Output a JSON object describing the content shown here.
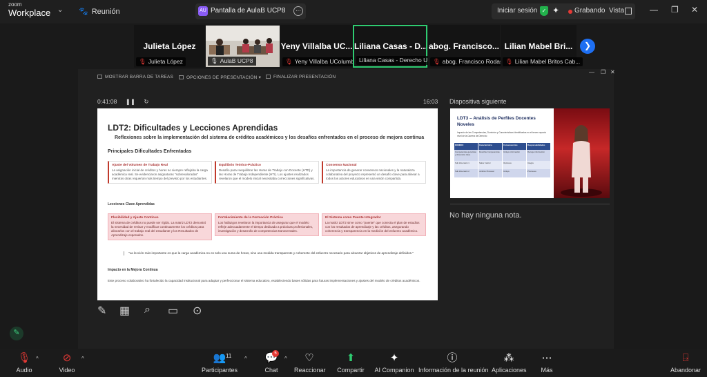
{
  "app": {
    "brand_small": "zoom",
    "brand_big": "Workplace",
    "meeting_label": "Reunión"
  },
  "share": {
    "badge": "AU",
    "title": "Pantalla de AulaB UCP8"
  },
  "topright": {
    "login": "Iniciar sesión",
    "recording": "Grabando",
    "view": "Vista"
  },
  "participants": [
    {
      "name": "Julieta López",
      "label": "Julieta López"
    },
    {
      "name": "",
      "label": "AulaB UCP8"
    },
    {
      "name": "Yeny Villalba UC...",
      "label": "Yeny Villalba UColumb..."
    },
    {
      "name": "Liliana Casas - D...",
      "label": "Liliana Casas - Derecho U..."
    },
    {
      "name": "abog. Francisco...",
      "label": "abog. Francisco Rodas"
    },
    {
      "name": "Lilian Mabel Bri...",
      "label": "Lilian Mabel Britos Cab..."
    }
  ],
  "presenter": {
    "show_taskbar": "MOSTRAR BARRA DE TAREAS",
    "options": "OPCIONES DE PRESENTACIÓN ▾",
    "end": "FINALIZAR PRESENTACIÓN",
    "elapsed": "0:41:08",
    "clock": "16:03",
    "next_slide": "Diapositiva siguiente",
    "notes": "No hay ninguna nota."
  },
  "slide": {
    "title": "LDT2: Dificultades y Lecciones Aprendidas",
    "subtitle": "Reflexiones sobre la implementación del sistema de créditos académicos y los desafíos enfrentados en el proceso de mejora continua",
    "h_difficulties": "Principales Dificultades Enfrentadas",
    "cards": [
      {
        "title": "Ajuste del Volumen de Trabajo Real",
        "body": "La asignación inicial de créditos y horas no siempre reflejaba la carga académica real. Se evidenciaron asignaturas \"sobrevaloradas\" mientras otras requerían más tiempo del previsto por los estudiantes."
      },
      {
        "title": "Equilibrio Teórico-Práctico",
        "body": "Desafío para reequilibrar las Horas de Trabajo con Docente (HTD) y las Horas de Trabajo Independiente (HTI). Los ajustes realizados revelaron que el modelo inicial necesitaba correcciones significativas."
      },
      {
        "title": "Consenso Nacional",
        "body": "La importancia de generar consensos nacionales y la naturaleza colaborativa del proyecto representó un desafío clave para alinear a todos los actores educativos en una visión compartida."
      }
    ],
    "h_lessons": "Lecciones Clave Aprendidas",
    "lessons": [
      {
        "title": "Flexibilidad y Ajuste Continuo",
        "body": "El sistema de créditos no puede ser rígido. La matriz LDT2 demostró la necesidad de revisar y modificar continuamente los créditos para alinearlos con el trabajo real del estudiante y los Resultados de Aprendizaje esperados."
      },
      {
        "title": "Fortalecimiento de la Formación Práctica",
        "body": "Los hallazgos revelaron la importancia de asegurar que el modelo refleje adecuadamente el tiempo dedicado a prácticas profesionales, investigación y desarrollo de competencias transversales."
      },
      {
        "title": "El Sistema como Puente Integrador",
        "body": "La matriz LDT2 sirve como \"puente\" que conecta el plan de estudios con los resultados de aprendizaje y las créditos, asegurando coherencia y transparencia en la medición del esfuerzo académico."
      }
    ],
    "quote": "\"La lección más importante es que la carga académica no es solo una suma de horas, sino una medida transparente y coherente del esfuerzo necesario para alcanzar objetivos de aprendizaje definidos.\"",
    "h_impact": "Impacto en la Mejora Continua",
    "impact": "Este proceso colaborativo ha fortalecido la capacidad institucional para adaptar y perfeccionar el sistema educativo, estableciendo bases sólidas para futuras implementaciones y ajustes del modelo de créditos académicos."
  },
  "next": {
    "title": "LDT3 – Análisis de Perfiles Docentes Noveles",
    "sub": "Impacto de las Competencias, Dominios y Características Identificadas en el tercer espacio nivel de la Carrera de Derecho",
    "table_head": [
      "DOMINIO",
      "Característica",
      "Consecuencias",
      "Responsabilidades"
    ],
    "table_rows": [
      [
        "Competencias genéricas y dimensión clave",
        "Describe Competencias",
        "Incluye información",
        "Recoge información"
      ],
      [
        "Sub dimensión 1",
        "Saber instruir",
        "Opciones",
        "Integra"
      ],
      [
        "Sub dimensión 2",
        "Jurídico Procesal",
        "Incluye",
        "Promueve"
      ]
    ]
  },
  "bottom": {
    "audio": "Audio",
    "video": "Video",
    "participants": "Participantes",
    "participants_count": "11",
    "chat": "Chat",
    "chat_badge": "5",
    "reactions": "Reaccionar",
    "share": "Compartir",
    "companion": "AI Companion",
    "info": "Información de la reunión",
    "apps": "Aplicaciones",
    "more": "Más",
    "leave": "Abandonar"
  }
}
